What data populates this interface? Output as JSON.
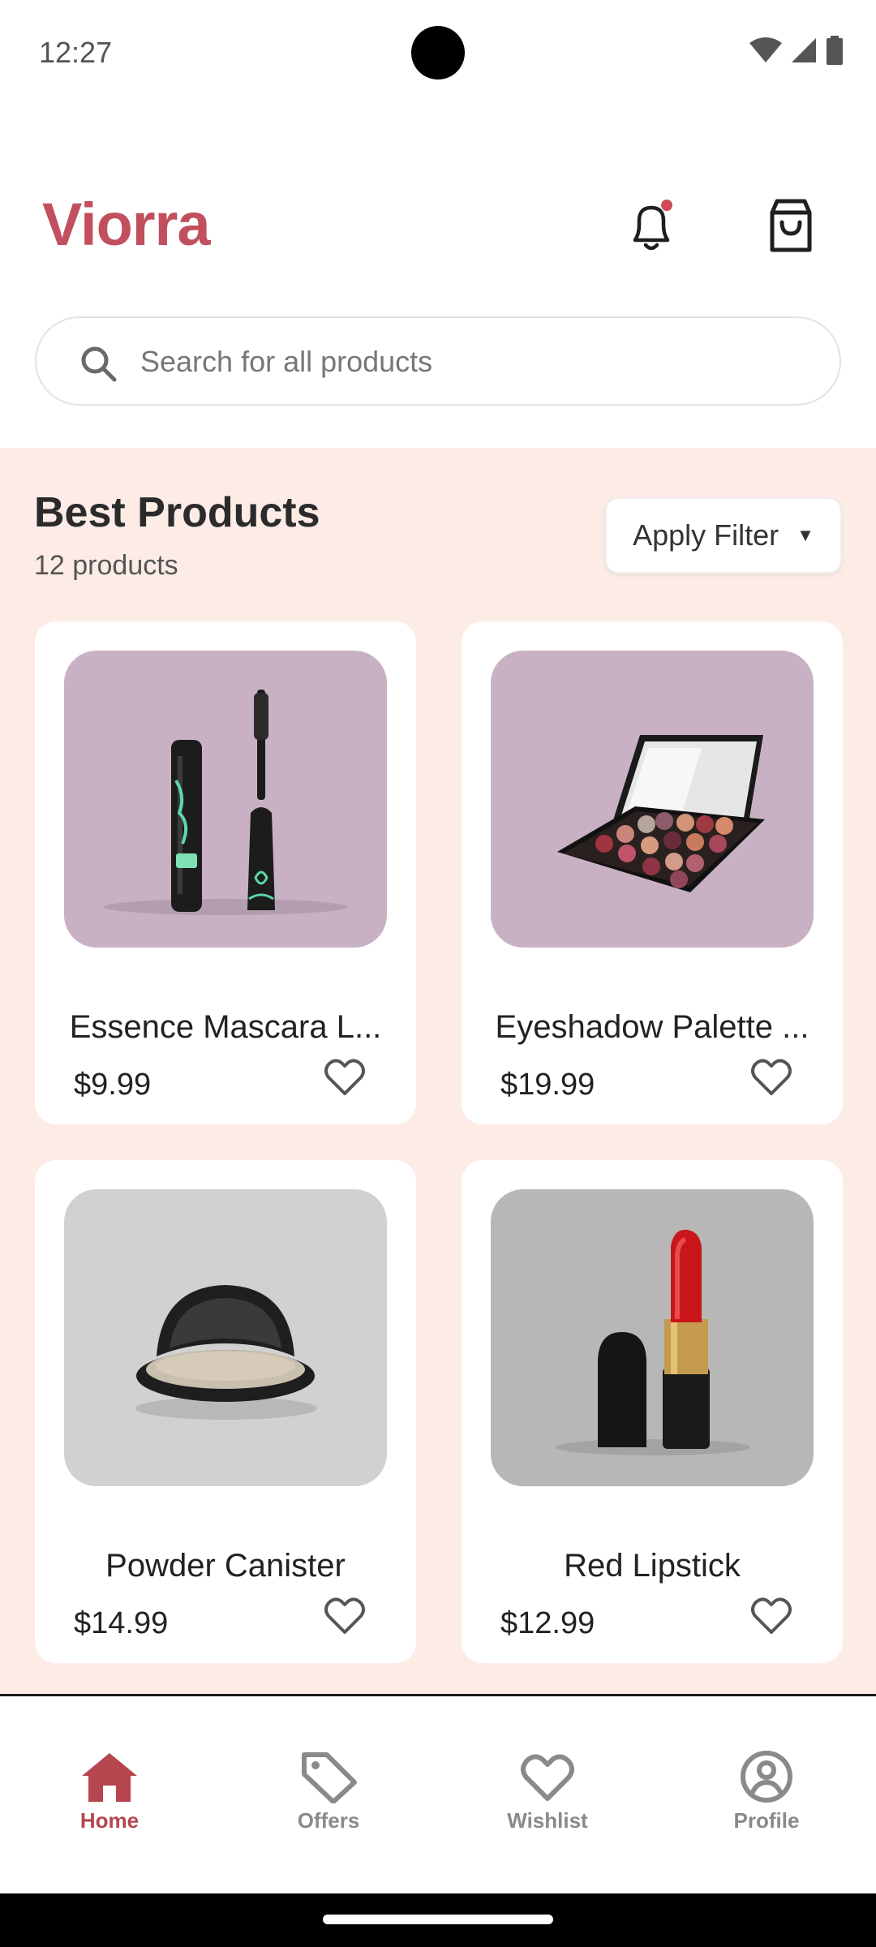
{
  "status_bar": {
    "time": "12:27"
  },
  "header": {
    "brand": "Viorra",
    "search": {
      "placeholder": "Search for all products",
      "value": ""
    }
  },
  "products_section": {
    "title": "Best Products",
    "count": "12 products",
    "filter_label": "Apply Filter"
  },
  "products": [
    {
      "name": "Essence Mascara L...",
      "price": "$9.99",
      "image_bg": "#c9b1c4",
      "image_type": "mascara"
    },
    {
      "name": "Eyeshadow Palette ...",
      "price": "$19.99",
      "image_bg": "#c9b1c4",
      "image_type": "eyeshadow-palette"
    },
    {
      "name": "Powder Canister",
      "price": "$14.99",
      "image_bg": "#d1d1d1",
      "image_type": "powder-compact"
    },
    {
      "name": "Red Lipstick",
      "price": "$12.99",
      "image_bg": "#b7b7b7",
      "image_type": "lipstick"
    }
  ],
  "bottom_nav": [
    {
      "label": "Home",
      "icon": "home-icon",
      "active": true
    },
    {
      "label": "Offers",
      "icon": "tag-icon",
      "active": false
    },
    {
      "label": "Wishlist",
      "icon": "heart-icon",
      "active": false
    },
    {
      "label": "Profile",
      "icon": "user-circle-icon",
      "active": false
    }
  ],
  "colors": {
    "brand": "#c14f5e",
    "content_bg": "#fdece6",
    "nav_active": "#b5454f",
    "nav_inactive": "#8a8a8a"
  }
}
